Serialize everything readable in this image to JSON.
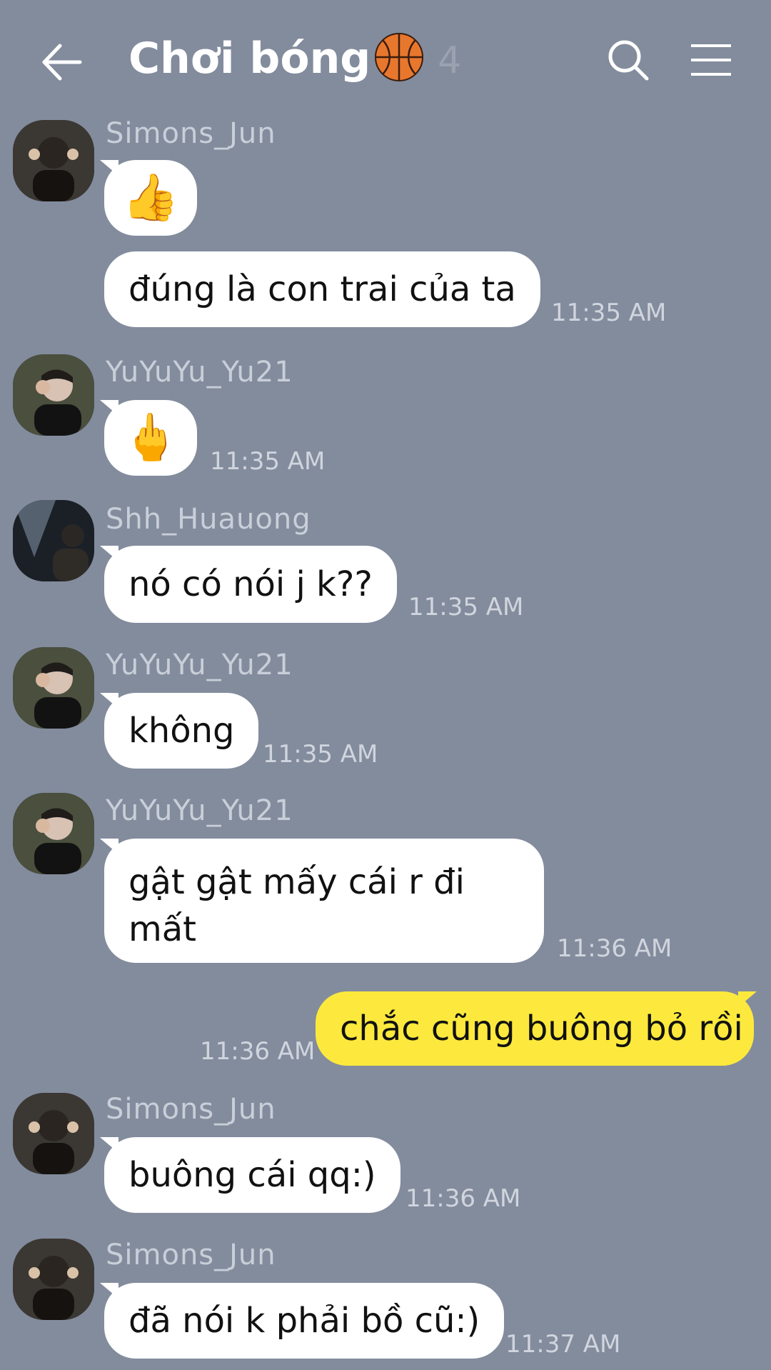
{
  "header": {
    "title": "Chơi bóng",
    "title_icon": "basketball-icon",
    "member_count": "4",
    "icons": {
      "back": "back-arrow-icon",
      "search": "search-icon",
      "menu": "hamburger-menu-icon"
    }
  },
  "messages": [
    {
      "sender": "Simons_Jun",
      "text": "👍"
    },
    {
      "text": "đúng là con trai của ta",
      "time": "11:35 AM"
    },
    {
      "sender": "YuYuYu_Yu21",
      "text": "🖕",
      "time": "11:35 AM"
    },
    {
      "sender": "Shh_Huauong",
      "text": "nó có nói j k??",
      "time": "11:35 AM"
    },
    {
      "sender": "YuYuYu_Yu21",
      "text": "không",
      "time": "11:35 AM"
    },
    {
      "sender": "YuYuYu_Yu21",
      "text": "gật gật mấy cái r đi mất",
      "time": "11:36 AM"
    },
    {
      "mine": true,
      "text": "chắc cũng buông bỏ rồi",
      "time": "11:36 AM"
    },
    {
      "sender": "Simons_Jun",
      "text": "buông cái qq:)",
      "time": "11:36 AM"
    },
    {
      "sender": "Simons_Jun",
      "text": "đã nói k phải bồ cũ:)",
      "time": "11:37 AM"
    }
  ],
  "colors": {
    "background": "#838c9d",
    "my_bubble": "#fde93d",
    "other_bubble": "#ffffff"
  }
}
